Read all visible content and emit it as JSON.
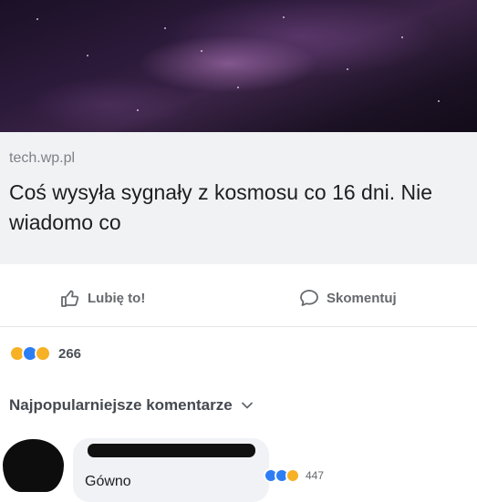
{
  "post": {
    "link_domain": "tech.wp.pl",
    "headline": "Coś wysyła sygnały z kosmosu co 16 dni. Nie wiadomo co"
  },
  "actions": {
    "like_label": "Lubię to!",
    "comment_label": "Skomentuj"
  },
  "reactions": {
    "icons": [
      "haha-reaction-icon",
      "like-reaction-icon",
      "wow-reaction-icon"
    ],
    "count": "266"
  },
  "comments": {
    "sort_label": "Najpopularniejsze komentarze",
    "items": [
      {
        "text": "Gówno",
        "reaction_icons": [
          "like-reaction-icon",
          "love-reaction-icon",
          "haha-reaction-icon"
        ],
        "reaction_count": "447"
      }
    ]
  },
  "colors": {
    "link_card_bg": "#f1f2f4",
    "like_blue": "#2d7ef5",
    "reaction_yellow": "#f7b125",
    "muted_text": "#7d8186"
  }
}
